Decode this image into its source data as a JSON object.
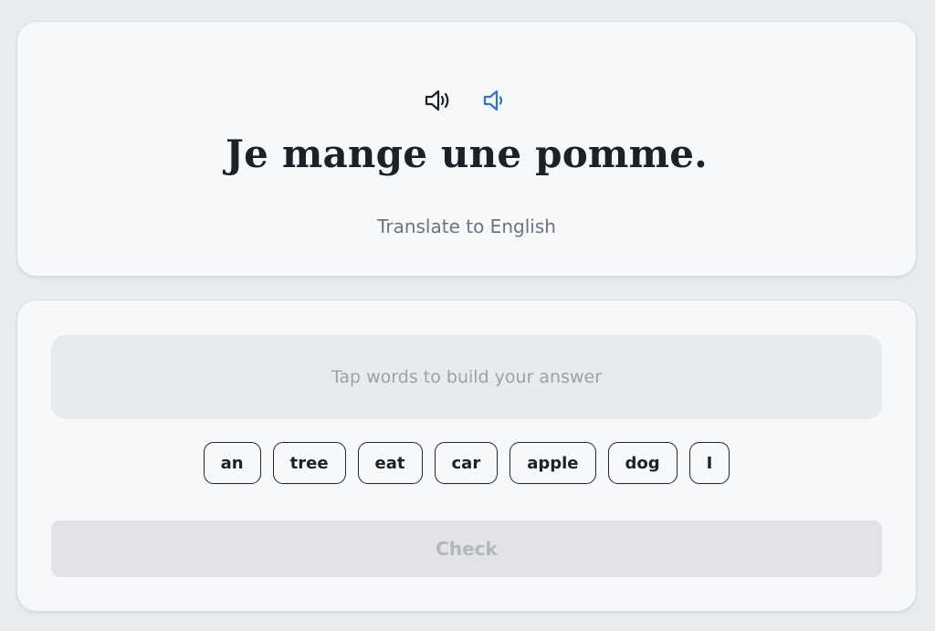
{
  "prompt": {
    "audio_buttons": [
      {
        "icon": "speaker-icon",
        "color": "#1b2129"
      },
      {
        "icon": "speaker-slow-icon",
        "color": "#2a74c9"
      }
    ],
    "sentence": "Je mange une pomme.",
    "instruction": "Translate to English"
  },
  "answer": {
    "placeholder": "Tap words to build your answer",
    "word_bank": [
      "an",
      "tree",
      "eat",
      "car",
      "apple",
      "dog",
      "I"
    ],
    "check_label": "Check"
  }
}
